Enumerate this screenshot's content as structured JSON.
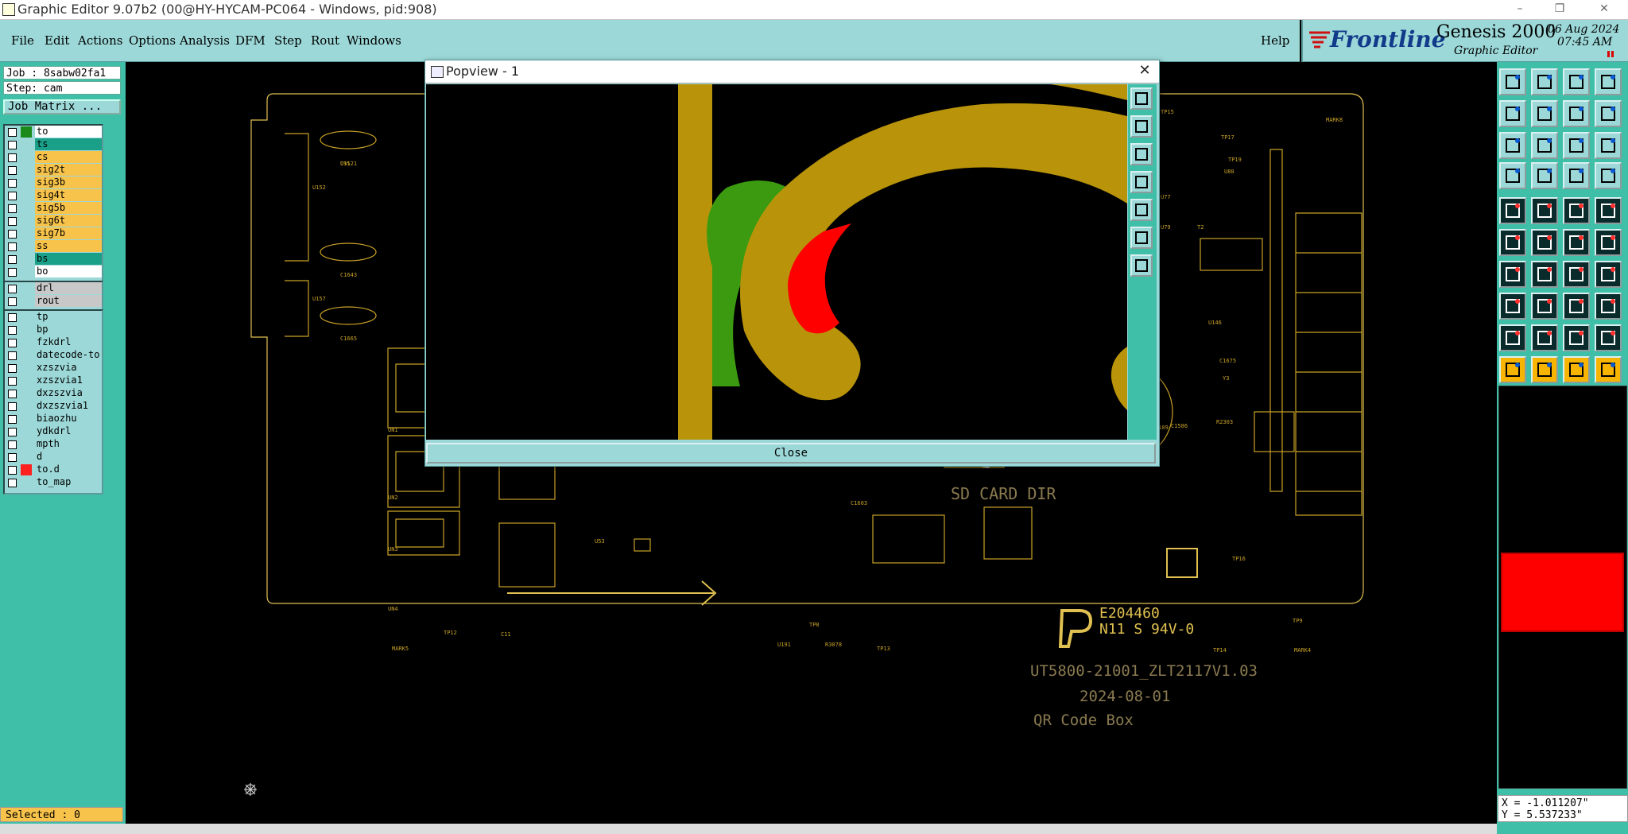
{
  "window": {
    "title": "Graphic Editor 9.07b2 (00@HY-HYCAM-PC064 - Windows, pid:908)"
  },
  "menu": {
    "items": [
      "File",
      "Edit",
      "Actions",
      "Options",
      "Analysis",
      "DFM",
      "Step",
      "Rout",
      "Windows"
    ],
    "help": "Help"
  },
  "brand": {
    "logo": "Frontline",
    "product": "Genesis 2000",
    "subtitle": "Graphic Editor",
    "date": "06 Aug 2024",
    "time": "07:45 AM"
  },
  "job": {
    "job_label": "Job : 8sabw02fa1",
    "step_label": "Step: cam",
    "matrix_button": "Job Matrix ..."
  },
  "layers": {
    "board": [
      {
        "name": "to",
        "color": "#ffffff",
        "swatch": "#1a8a1a"
      },
      {
        "name": "ts",
        "color": "#1aa088",
        "swatch": ""
      },
      {
        "name": "cs",
        "color": "#f7c34a",
        "swatch": ""
      },
      {
        "name": "sig2t",
        "color": "#f7c34a",
        "swatch": ""
      },
      {
        "name": "sig3b",
        "color": "#f7c34a",
        "swatch": ""
      },
      {
        "name": "sig4t",
        "color": "#f7c34a",
        "swatch": ""
      },
      {
        "name": "sig5b",
        "color": "#f7c34a",
        "swatch": ""
      },
      {
        "name": "sig6t",
        "color": "#f7c34a",
        "swatch": ""
      },
      {
        "name": "sig7b",
        "color": "#f7c34a",
        "swatch": ""
      },
      {
        "name": "ss",
        "color": "#f7c34a",
        "swatch": ""
      },
      {
        "name": "bs",
        "color": "#1aa088",
        "swatch": ""
      },
      {
        "name": "bo",
        "color": "#ffffff",
        "swatch": ""
      }
    ],
    "drill": [
      {
        "name": "drl",
        "color": "#c8c8c8",
        "swatch": ""
      },
      {
        "name": "rout",
        "color": "#c8c8c8",
        "swatch": ""
      }
    ],
    "misc": [
      {
        "name": "tp",
        "color": "#9cd8d8",
        "swatch": ""
      },
      {
        "name": "bp",
        "color": "#9cd8d8",
        "swatch": ""
      },
      {
        "name": "fzkdrl",
        "color": "#9cd8d8",
        "swatch": ""
      },
      {
        "name": "datecode-to",
        "color": "#9cd8d8",
        "swatch": ""
      },
      {
        "name": "xzszvia",
        "color": "#9cd8d8",
        "swatch": ""
      },
      {
        "name": "xzszvia1",
        "color": "#9cd8d8",
        "swatch": ""
      },
      {
        "name": "dxzszvia",
        "color": "#9cd8d8",
        "swatch": ""
      },
      {
        "name": "dxzszvia1",
        "color": "#9cd8d8",
        "swatch": ""
      },
      {
        "name": "biaozhu",
        "color": "#9cd8d8",
        "swatch": ""
      },
      {
        "name": "ydkdrl",
        "color": "#9cd8d8",
        "swatch": ""
      },
      {
        "name": "mpth",
        "color": "#9cd8d8",
        "swatch": ""
      },
      {
        "name": "d",
        "color": "#9cd8d8",
        "swatch": ""
      },
      {
        "name": "to.d",
        "color": "#9cd8d8",
        "swatch": "#ff2020"
      },
      {
        "name": "to_map",
        "color": "#9cd8d8",
        "swatch": ""
      }
    ]
  },
  "status": {
    "selected": "Selected : 0",
    "x": "X = -1.011207\"",
    "y": "Y = 5.537233\""
  },
  "board": {
    "sd_card": "SD CARD DIR",
    "cert1": "E204460",
    "cert2": "N11 S 94V-0",
    "part_no": "UT5800-21001_ZLT2117V1.03",
    "date": "2024-08-01",
    "qr": "QR Code Box",
    "refs": [
      "C1521",
      "C1643",
      "C1665",
      "U152",
      "U157",
      "UN1",
      "UN2",
      "UN3",
      "UN4",
      "U53",
      "TP12",
      "C11",
      "MARK5",
      "TP13",
      "TP8",
      "U191",
      "R3078",
      "TP15",
      "TP17",
      "TP19",
      "MARK8",
      "U77",
      "U79",
      "U80",
      "TP16",
      "TP9",
      "TP14",
      "MARK4",
      "C1675",
      "Y3",
      "U146",
      "T2",
      "R418",
      "C1586",
      "U189",
      "R2303",
      "C1603",
      "C13",
      "U61",
      "U1",
      "R1152",
      "X1",
      "U91"
    ]
  },
  "popview": {
    "title": "Popview - 1",
    "close": "Close"
  }
}
